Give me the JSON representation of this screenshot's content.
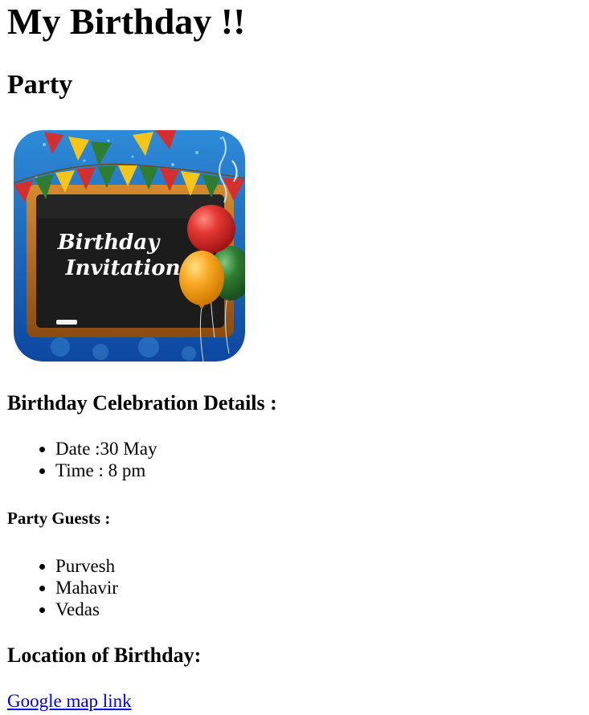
{
  "heading": "My Birthday !!",
  "subheading": "Party",
  "invitation_image": {
    "text_line1": "Birthday",
    "text_line2": "Invitation",
    "colors": {
      "frame_blue": "#1565c0",
      "board": "#1c1c1c",
      "wood": "#b8691f",
      "balloon_red": "#e53935",
      "balloon_orange": "#f9a825",
      "balloon_green": "#2e7d32",
      "flag_yellow": "#f5c518"
    }
  },
  "details": {
    "heading": "Birthday Celebration Details :",
    "items": [
      "Date :30 May",
      "Time : 8 pm"
    ]
  },
  "guests": {
    "heading": "Party Guests :",
    "items": [
      "Purvesh",
      "Mahavir",
      "Vedas"
    ]
  },
  "location": {
    "heading": "Location of Birthday:",
    "link_text": "Google map link"
  }
}
